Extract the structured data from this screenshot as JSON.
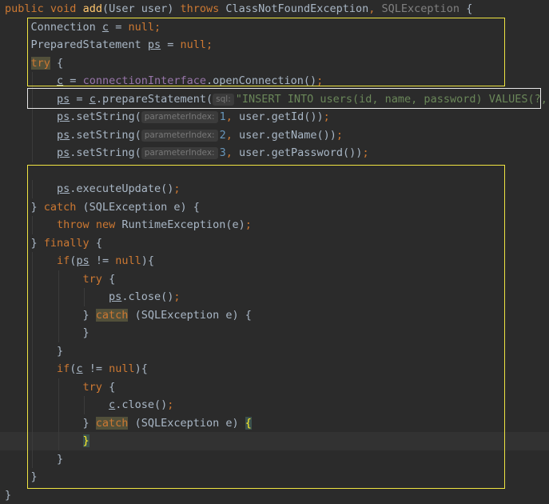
{
  "editor": {
    "language": "java",
    "cursor_line": 24,
    "lines": [
      "public void add(User user) throws ClassNotFoundException, SQLException {",
      "    Connection c = null;",
      "    PreparedStatement ps = null;",
      "    try {",
      "        c = connectionInterface.openConnection();",
      "        ps = c.prepareStatement(\"INSERT INTO users(id, name, password) VALUES(?,",
      "        ps.setString(1, user.getId());",
      "        ps.setString(2, user.getName());",
      "        ps.setString(3, user.getPassword());",
      "",
      "        ps.executeUpdate();",
      "    } catch (SQLException e) {",
      "        throw new RuntimeException(e);",
      "    } finally {",
      "        if(ps != null){",
      "            try {",
      "                ps.close();",
      "            } catch (SQLException e) {",
      "            }",
      "        }",
      "        if(c != null){",
      "            try {",
      "                c.close();",
      "            } catch (SQLException e) {",
      "            }",
      "        }",
      "    }",
      "}"
    ],
    "inlay_hints": [
      "sql:",
      "parameterIndex:",
      "parameterIndex:",
      "parameterIndex:"
    ]
  },
  "highlight_colors": {
    "box_yellow": "#f0e542",
    "box_white": "#e8e8e8",
    "background": "#2b2b2b"
  }
}
